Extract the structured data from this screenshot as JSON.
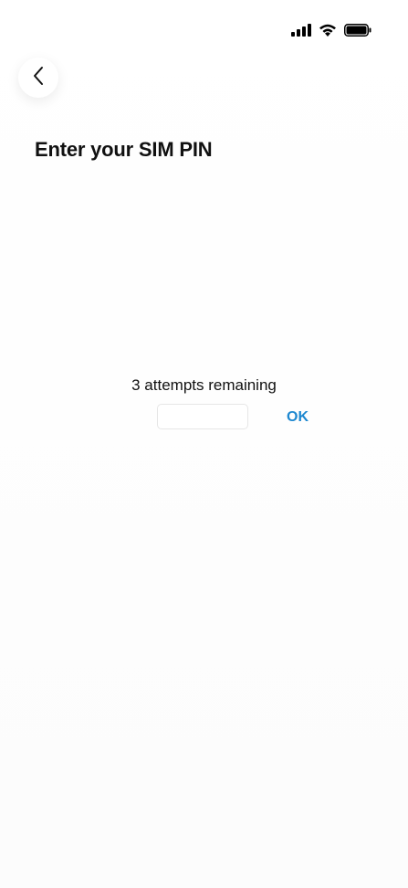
{
  "status_bar": {
    "signal_icon": "cellular-signal-icon",
    "wifi_icon": "wifi-icon",
    "battery_icon": "battery-icon"
  },
  "header": {
    "back_icon": "chevron-left-icon",
    "title": "Enter your SIM PIN"
  },
  "pin_entry": {
    "attempts_text": "3 attempts remaining",
    "input_value": "",
    "input_placeholder": "",
    "ok_label": "OK"
  },
  "colors": {
    "accent": "#1e88d0",
    "text": "#111111",
    "background": "#fdfdfd"
  }
}
